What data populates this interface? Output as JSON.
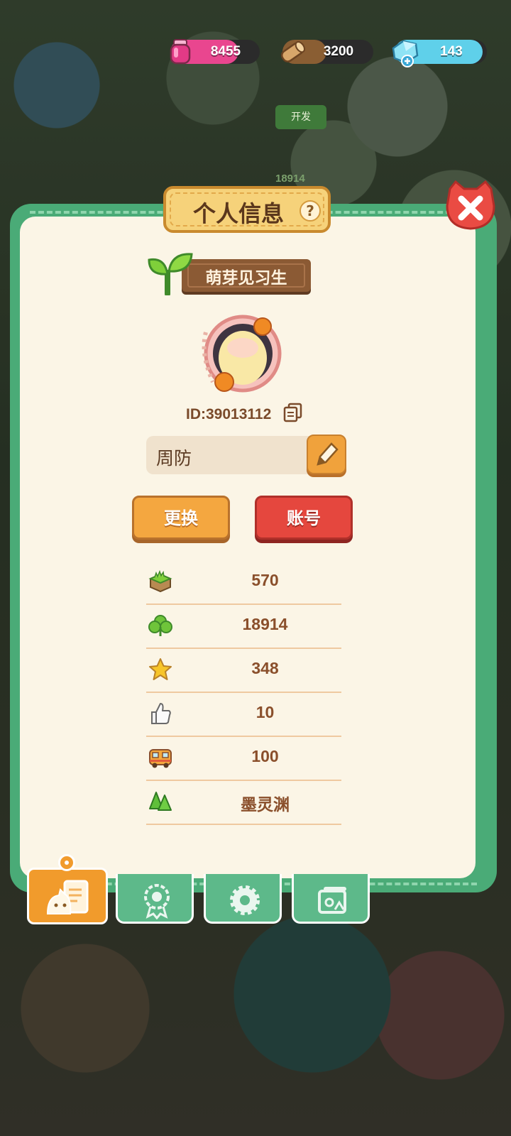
{
  "resources": [
    {
      "name": "pink-potion",
      "value": "8455",
      "color": "#e9468f"
    },
    {
      "name": "wood-log",
      "value": "3200",
      "color": "#8a5e33"
    },
    {
      "name": "blue-gem",
      "value": "143",
      "color": "#5fd0ea"
    }
  ],
  "background": {
    "dev_button": "开发",
    "number": "18914"
  },
  "panel": {
    "title": "个人信息",
    "help": "?",
    "rank": "萌芽见习生",
    "user_id": "ID:39013112",
    "name": "周防",
    "change_button": "更换",
    "account_button": "账号"
  },
  "stats": [
    {
      "icon": "grass-block-icon",
      "value": "570"
    },
    {
      "icon": "clover-icon",
      "value": "18914"
    },
    {
      "icon": "star-icon",
      "value": "348"
    },
    {
      "icon": "thumbs-up-icon",
      "value": "10"
    },
    {
      "icon": "bus-icon",
      "value": "100"
    },
    {
      "icon": "trees-icon",
      "value": "墨灵渊"
    }
  ],
  "tabs": [
    "profile-tab",
    "badge-tab",
    "settings-tab",
    "album-tab"
  ],
  "colors": {
    "panel_green": "#4aab77",
    "panel_cream": "#fbf5e6",
    "orange": "#f4a740",
    "red": "#e5473e"
  }
}
